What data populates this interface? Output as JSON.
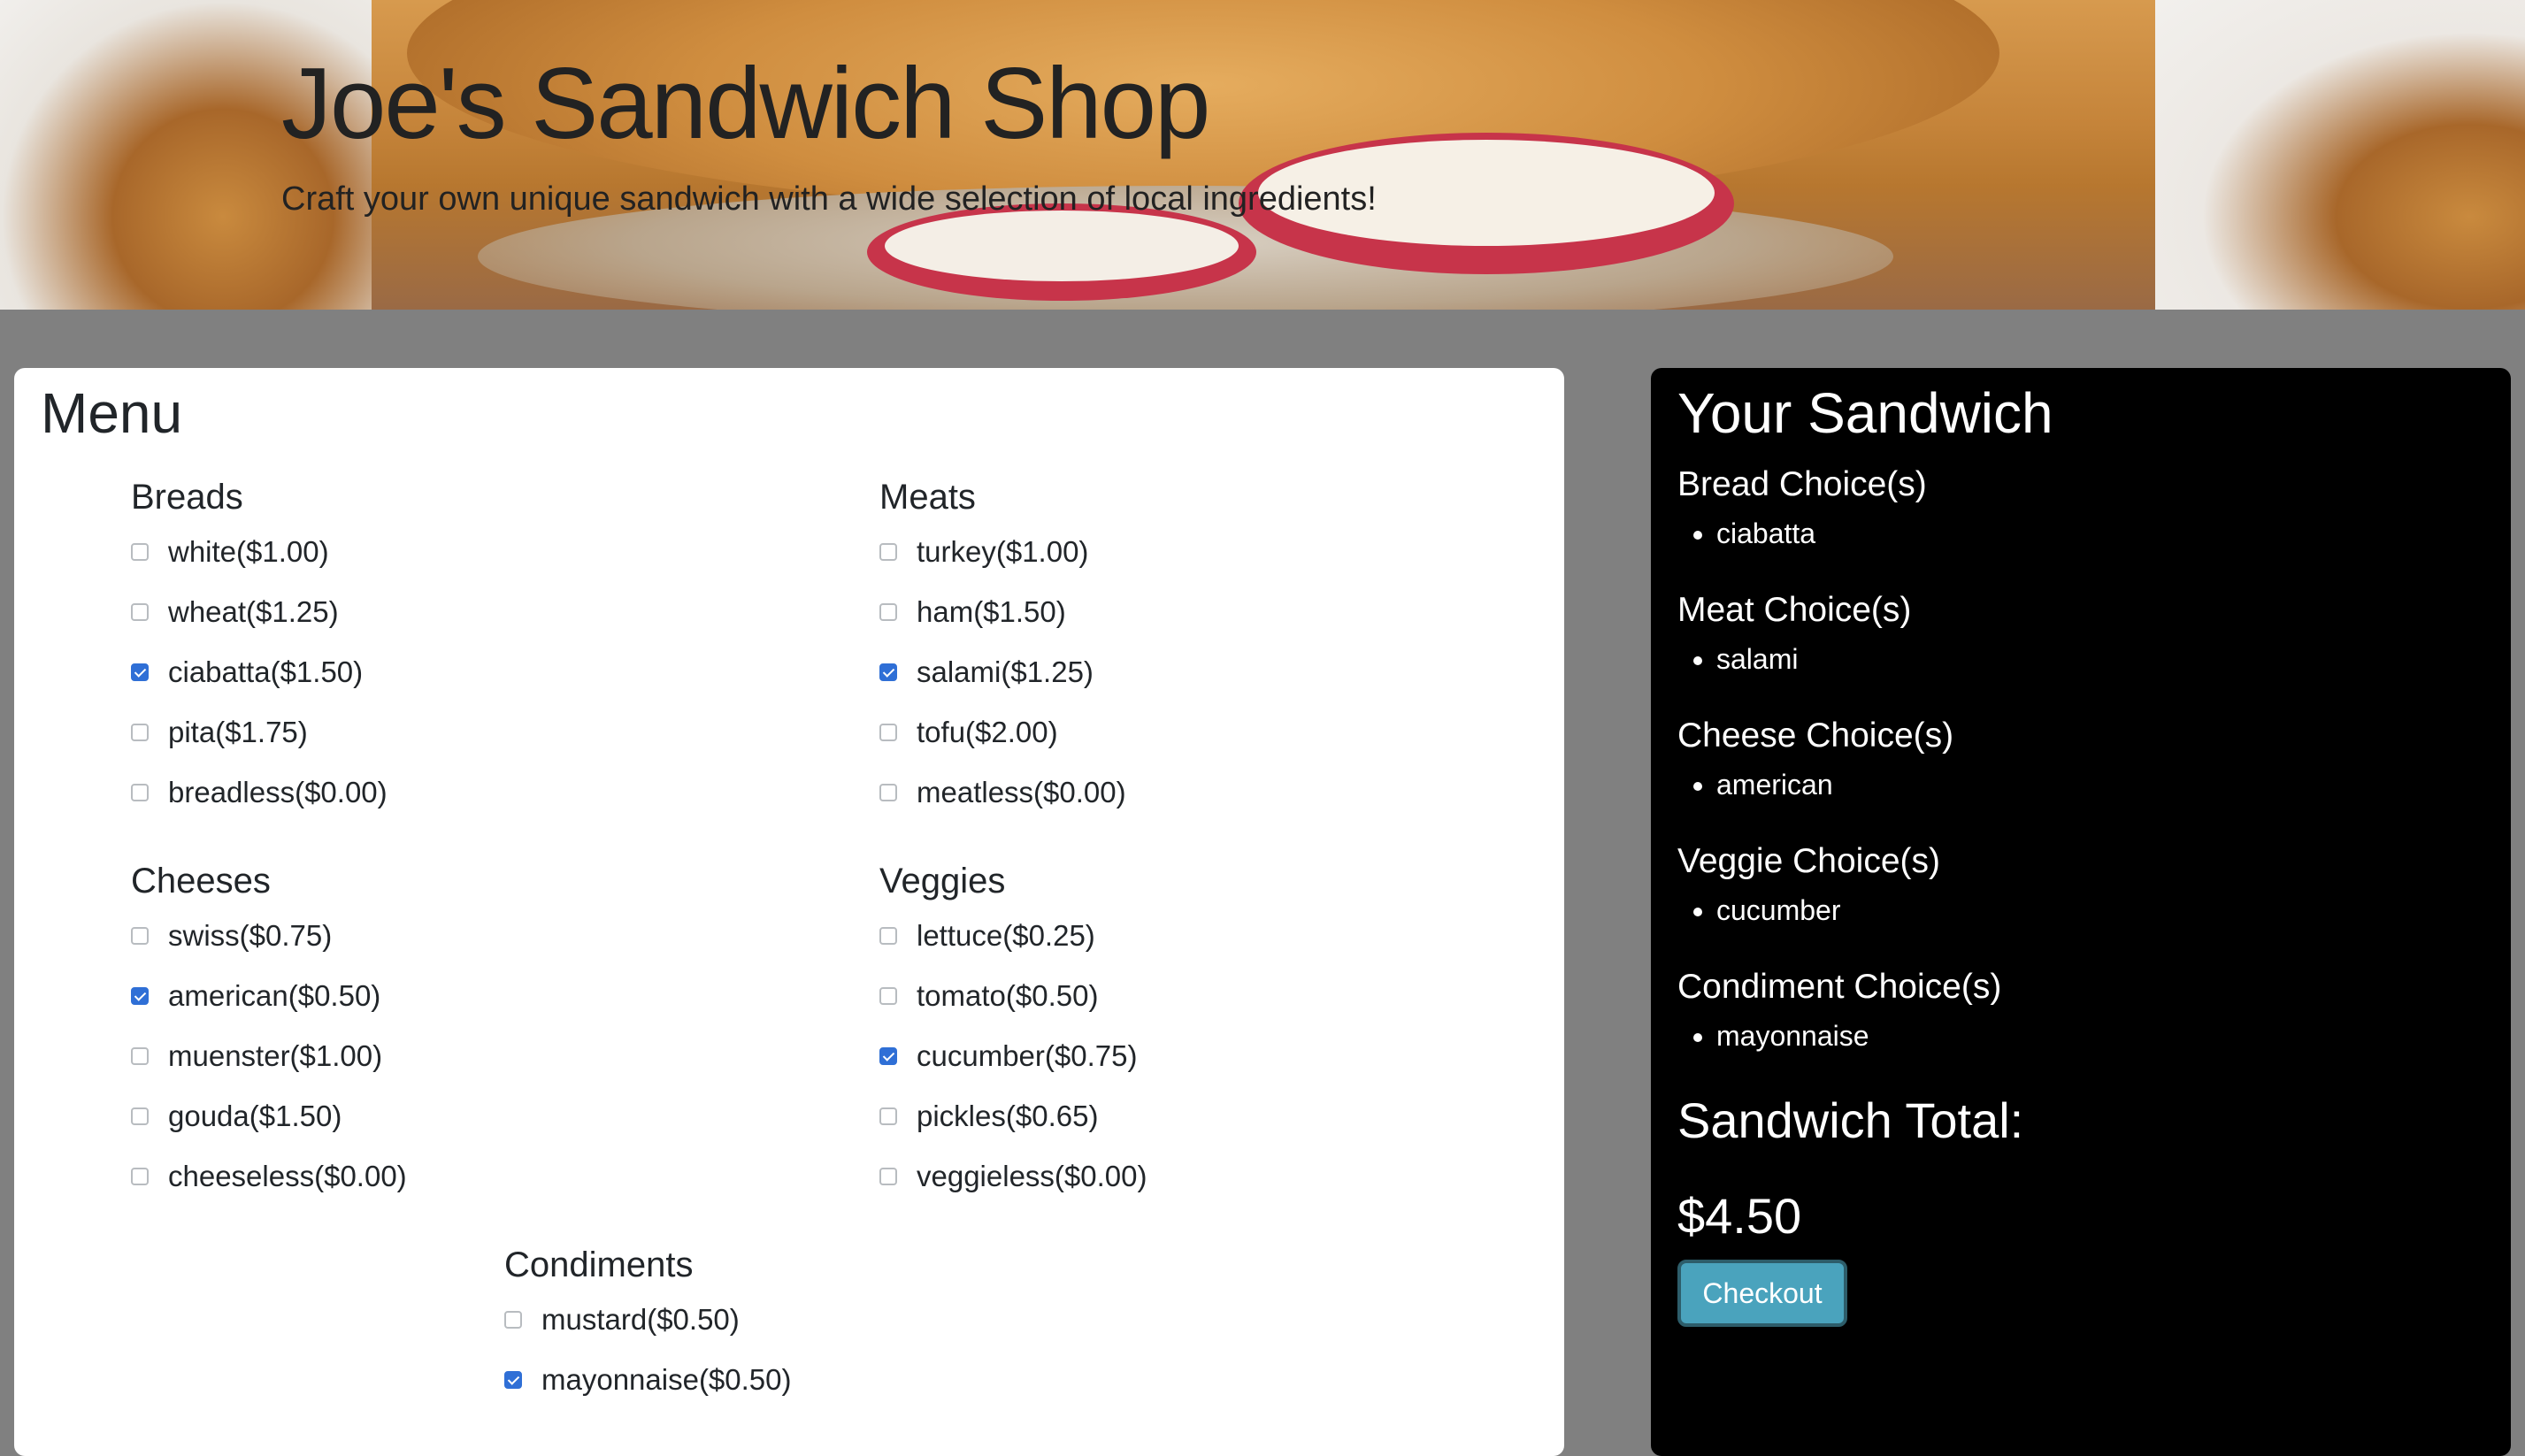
{
  "header": {
    "title": "Joe's Sandwich Shop",
    "subtitle": "Craft your own unique sandwich with a wide selection of local ingredients!"
  },
  "menu": {
    "title": "Menu",
    "groups": {
      "breads": {
        "heading": "Breads",
        "items": [
          {
            "label": "white($1.00)",
            "checked": false
          },
          {
            "label": "wheat($1.25)",
            "checked": false
          },
          {
            "label": "ciabatta($1.50)",
            "checked": true
          },
          {
            "label": "pita($1.75)",
            "checked": false
          },
          {
            "label": "breadless($0.00)",
            "checked": false
          }
        ]
      },
      "meats": {
        "heading": "Meats",
        "items": [
          {
            "label": "turkey($1.00)",
            "checked": false
          },
          {
            "label": "ham($1.50)",
            "checked": false
          },
          {
            "label": "salami($1.25)",
            "checked": true
          },
          {
            "label": "tofu($2.00)",
            "checked": false
          },
          {
            "label": "meatless($0.00)",
            "checked": false
          }
        ]
      },
      "cheeses": {
        "heading": "Cheeses",
        "items": [
          {
            "label": "swiss($0.75)",
            "checked": false
          },
          {
            "label": "american($0.50)",
            "checked": true
          },
          {
            "label": "muenster($1.00)",
            "checked": false
          },
          {
            "label": "gouda($1.50)",
            "checked": false
          },
          {
            "label": "cheeseless($0.00)",
            "checked": false
          }
        ]
      },
      "veggies": {
        "heading": "Veggies",
        "items": [
          {
            "label": "lettuce($0.25)",
            "checked": false
          },
          {
            "label": "tomato($0.50)",
            "checked": false
          },
          {
            "label": "cucumber($0.75)",
            "checked": true
          },
          {
            "label": "pickles($0.65)",
            "checked": false
          },
          {
            "label": "veggieless($0.00)",
            "checked": false
          }
        ]
      },
      "condiments": {
        "heading": "Condiments",
        "items": [
          {
            "label": "mustard($0.50)",
            "checked": false
          },
          {
            "label": "mayonnaise($0.50)",
            "checked": true
          }
        ]
      }
    }
  },
  "sandwich": {
    "title": "Your Sandwich",
    "sections": [
      {
        "heading": "Bread Choice(s)",
        "items": [
          "ciabatta"
        ]
      },
      {
        "heading": "Meat Choice(s)",
        "items": [
          "salami"
        ]
      },
      {
        "heading": "Cheese Choice(s)",
        "items": [
          "american"
        ]
      },
      {
        "heading": "Veggie Choice(s)",
        "items": [
          "cucumber"
        ]
      },
      {
        "heading": "Condiment Choice(s)",
        "items": [
          "mayonnaise"
        ]
      }
    ],
    "total_label": "Sandwich Total:",
    "total_value": "$4.50",
    "checkout_label": "Checkout"
  },
  "colors": {
    "page_bg": "#808080",
    "checkbox_checked": "#2f6fd6",
    "checkout_button": "#4aa3bd",
    "sandwich_panel_bg": "#000000"
  }
}
